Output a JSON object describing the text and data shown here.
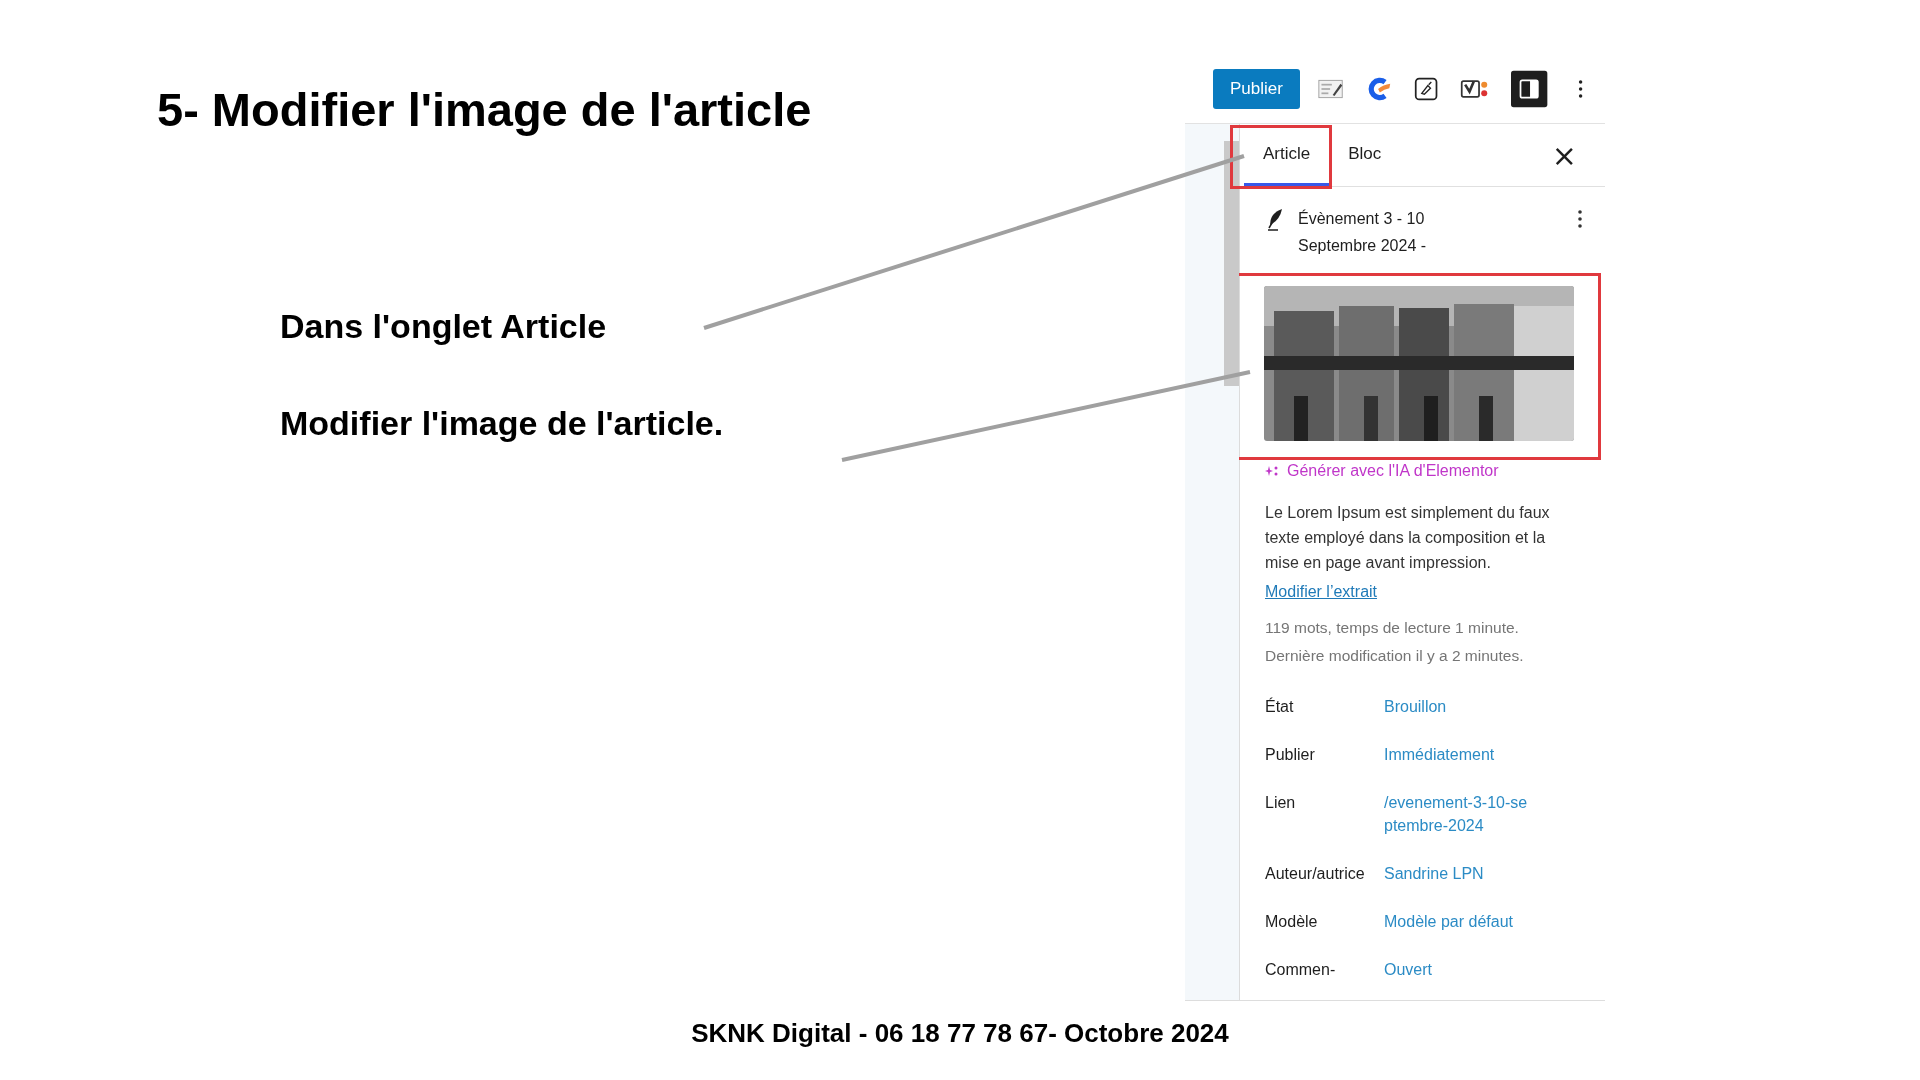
{
  "slide": {
    "title": "5- Modifier l'image de l'article",
    "instructions": [
      "Dans l'onglet Article",
      "Modifier l'image de l'article."
    ],
    "footer": "SKNK Digital - 06 18 77 78 67- Octobre 2024"
  },
  "screenshot": {
    "toolbar": {
      "publish_button": "Publier",
      "sidebar_toggle_on": true
    },
    "tabs": [
      {
        "label": "Article",
        "selected": true
      },
      {
        "label": "Bloc",
        "selected": false
      }
    ],
    "close": "×",
    "post_title": "Évènement 3 - 10 Septembre 2024 -",
    "ai_link": "Générer avec l'IA d'Elementor",
    "excerpt": "Le Lorem Ipsum est simplement du faux texte employé dans la composition et la mise en page avant impression.",
    "edit_excerpt_link": "Modifier l’extrait",
    "stats": [
      "119 mots, temps de lecture 1 minute.",
      "Dernière modification il y a 2 minutes."
    ],
    "fields": [
      {
        "label": "État",
        "value": "Brouillon"
      },
      {
        "label": "Publier",
        "value": "Immédiatement"
      },
      {
        "label": "Lien",
        "value": "/evenement-3-10-septembre-2024"
      },
      {
        "label": "Auteur/autrice",
        "value": "Sandrine LPN"
      },
      {
        "label": "Modèle",
        "value": "Modèle par défaut"
      },
      {
        "label": "Commen-",
        "value": "Ouvert"
      }
    ]
  }
}
